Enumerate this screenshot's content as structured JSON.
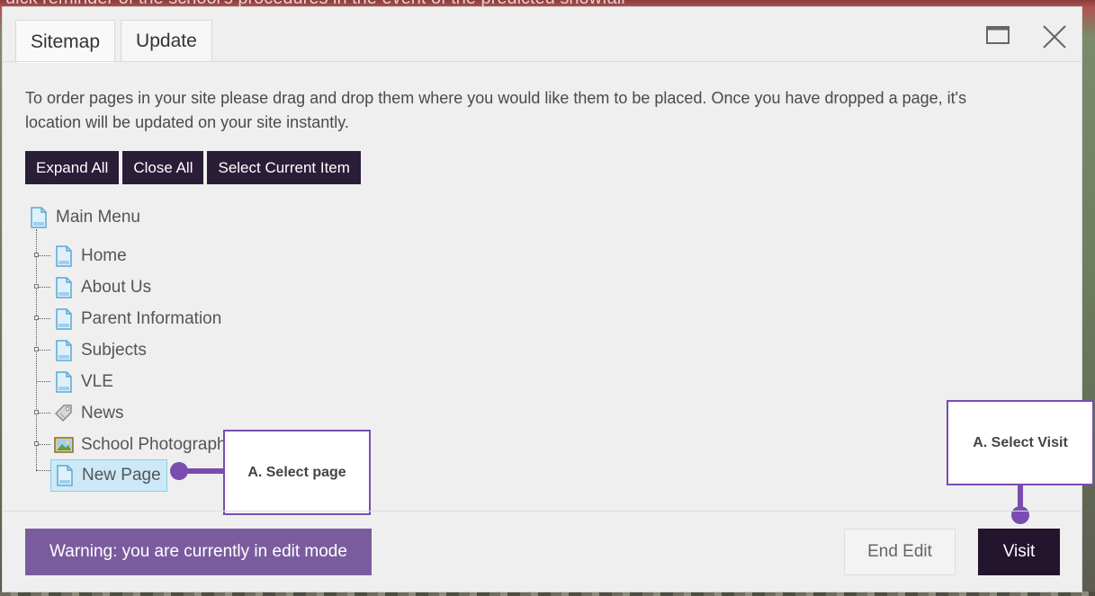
{
  "background": {
    "banner_text": "uick reminder of the school's procedures in the event of the predicted snowfall"
  },
  "dialog": {
    "tabs": [
      {
        "label": "Sitemap",
        "active": true
      },
      {
        "label": "Update",
        "active": false
      }
    ],
    "window_controls": [
      "maximize-icon",
      "close-icon"
    ],
    "intro_text": "To order pages in your site please drag and drop them where you would like them to be placed. Once you have dropped a page, it's location will be updated on your site instantly.",
    "toolbar": {
      "expand_all": "Expand All",
      "close_all": "Close All",
      "select_current": "Select Current Item"
    },
    "tree": {
      "root": {
        "label": "Main Menu",
        "icon": "page-icon"
      },
      "items": [
        {
          "label": "Home",
          "icon": "page-icon"
        },
        {
          "label": "About Us",
          "icon": "page-icon"
        },
        {
          "label": "Parent Information",
          "icon": "page-icon"
        },
        {
          "label": "Subjects",
          "icon": "page-icon"
        },
        {
          "label": "VLE",
          "icon": "page-icon"
        },
        {
          "label": "News",
          "icon": "tag-icon"
        },
        {
          "label": "School Photograph",
          "icon": "image-icon"
        },
        {
          "label": "New Page",
          "icon": "page-icon",
          "selected": true
        }
      ]
    },
    "callouts": {
      "select_page": "A. Select page",
      "select_visit": "A. Select Visit"
    },
    "footer": {
      "warning": "Warning: you are currently in edit mode",
      "end_edit": "End Edit",
      "visit": "Visit"
    }
  },
  "colors": {
    "toolbar_button": "#2a1d38",
    "warning": "#7a5c9e",
    "callout": "#7a4cb0",
    "selected_item": "#cde9f7"
  }
}
